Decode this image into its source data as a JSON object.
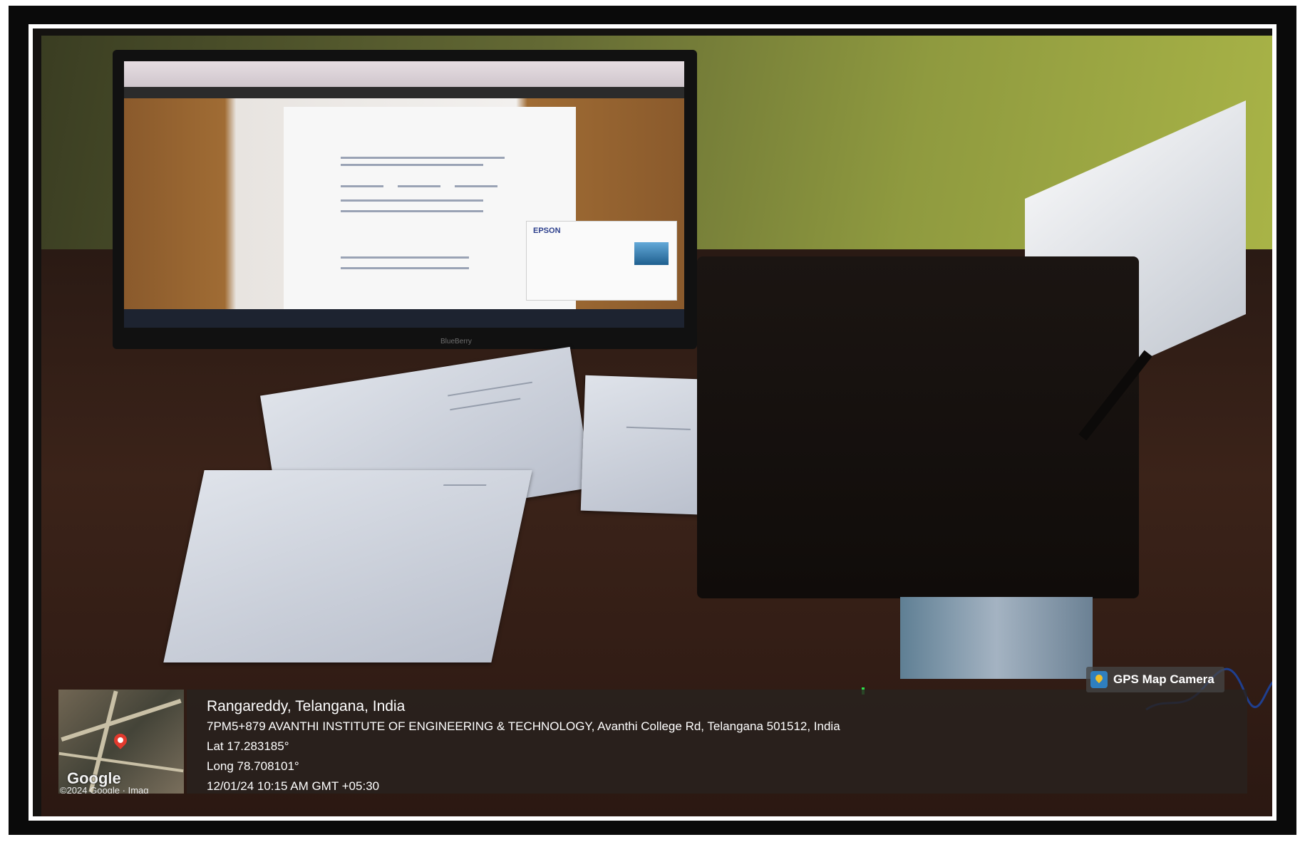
{
  "photo": {
    "subject": "",
    "monitor": {
      "dialog_brand": "EPSON",
      "brand_label": "BlueBerry"
    }
  },
  "gps_overlay": {
    "badge_label": "GPS Map Camera",
    "city": "Rangareddy, Telangana, India",
    "address": "7PM5+879 AVANTHI INSTITUTE OF ENGINEERING & TECHNOLOGY, Avanthi College Rd, Telangana 501512, India",
    "latitude": "Lat 17.283185°",
    "longitude": "Long 78.708101°",
    "datetime": "12/01/24 10:15 AM GMT +05:30",
    "map": {
      "logo": "Google",
      "credit": "©2024 Google · Imag"
    }
  },
  "colors": {
    "frame": "#0a0a0a",
    "border": "#ffffff",
    "overlay_bg": "#28221e",
    "pin": "#e23a2e",
    "badge_icon": "#2f7fbf"
  },
  "icons": [
    "gps-app-icon",
    "map-pin-icon"
  ]
}
